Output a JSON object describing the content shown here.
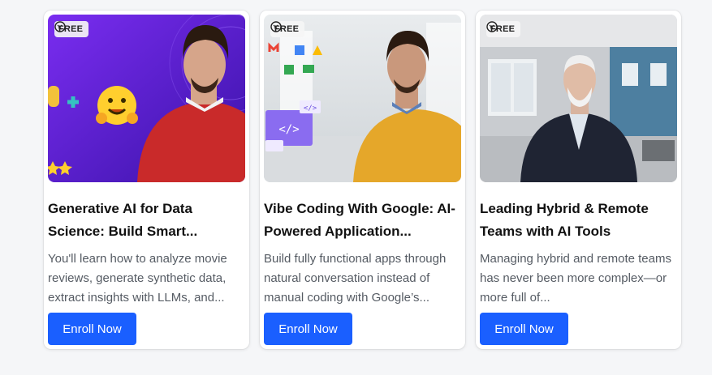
{
  "courses": [
    {
      "badge": "FREE",
      "title": "Generative AI for Data Science: Build Smart...",
      "description": "You'll learn how to analyze movie reviews, generate synthetic data, extract insights with LLMs, and...",
      "button": "Enroll Now"
    },
    {
      "badge": "FREE",
      "title": "Vibe Coding With Google: AI-Powered Application...",
      "description": "Build fully functional apps through natural conversation instead of manual coding with Google’s...",
      "button": "Enroll Now"
    },
    {
      "badge": "FREE",
      "title": "Leading Hybrid & Remote Teams with AI Tools",
      "description": "Managing hybrid and remote teams has never been more complex—or more full of...",
      "button": "Enroll Now"
    }
  ],
  "theme": {
    "button_color": "#1a5fff",
    "badge_icon": "free-tag-icon"
  }
}
